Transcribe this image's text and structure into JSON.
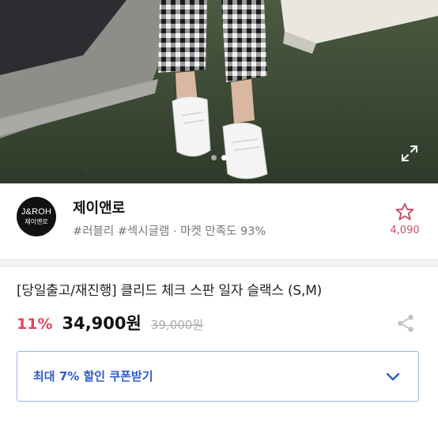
{
  "store": {
    "logo_line1": "J&ROH",
    "logo_line2": "제이앤로",
    "name": "제이앤로",
    "tags": "#러블리 #섹시글램 · 마켓 만족도 93%",
    "favorite_count": "4,090"
  },
  "product": {
    "title": "[당일출고/재진행] 클리드 체크 스판 일자 슬랙스 (S,M)",
    "discount": "11%",
    "price": "34,900원",
    "original_price": "39,000원"
  },
  "coupon": {
    "label": "최대 7% 할인 쿠폰받기"
  },
  "carousel": {
    "current_index": 2,
    "total": 2
  },
  "icons": {
    "expand": "expand-icon",
    "favorite": "star-outline-icon",
    "share": "share-icon",
    "chevron": "chevron-down-icon"
  },
  "colors": {
    "discount": "#e0455a",
    "favorite": "#c8506a",
    "coupon_text": "#2e5cc9",
    "coupon_border": "#9fb6e4"
  }
}
